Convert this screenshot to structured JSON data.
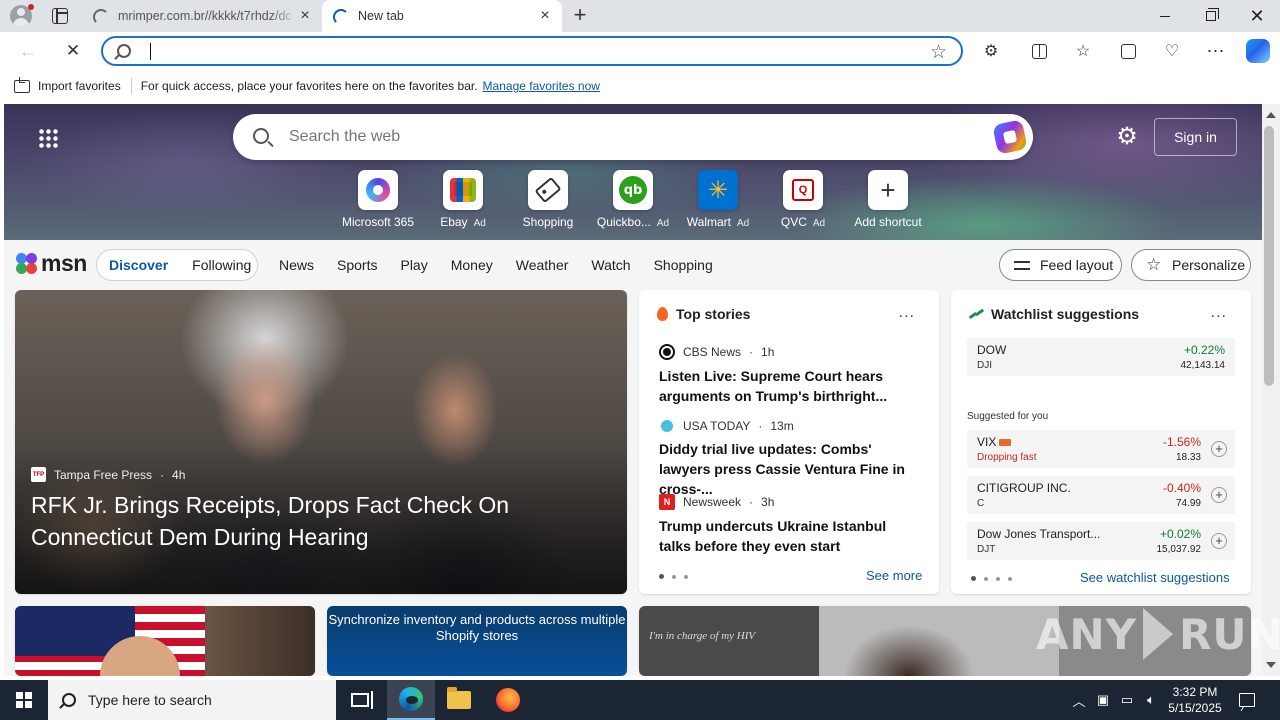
{
  "browser": {
    "tabs": [
      {
        "title": "mrimper.com.br//kkkk/t7rhdz/dc",
        "active": false
      },
      {
        "title": "New tab",
        "active": true
      }
    ],
    "address_value": "",
    "favorites_bar": {
      "import_label": "Import favorites",
      "message": "For quick access, place your favorites here on the favorites bar.",
      "manage_link": "Manage favorites now"
    }
  },
  "newtab": {
    "search_placeholder": "Search the web",
    "signin_label": "Sign in",
    "shortcuts": [
      {
        "label": "Microsoft 365",
        "ad": "",
        "icon": "microsoft-365-icon"
      },
      {
        "label": "Ebay",
        "ad": "Ad",
        "icon": "ebay-icon"
      },
      {
        "label": "Shopping",
        "ad": "",
        "icon": "tag-icon"
      },
      {
        "label": "Quickbo...",
        "ad": "Ad",
        "icon": "quickbooks-icon"
      },
      {
        "label": "Walmart",
        "ad": "Ad",
        "icon": "walmart-icon"
      },
      {
        "label": "QVC",
        "ad": "Ad",
        "icon": "qvc-icon"
      },
      {
        "label": "Add shortcut",
        "ad": "",
        "icon": "plus-icon"
      }
    ],
    "msn": {
      "logo": "msn",
      "pills": [
        "Discover",
        "Following"
      ],
      "links": [
        "News",
        "Sports",
        "Play",
        "Money",
        "Weather",
        "Watch",
        "Shopping"
      ],
      "feed_layout_label": "Feed layout",
      "personalize_label": "Personalize"
    },
    "hero": {
      "source": "Tampa Free Press",
      "time": "4h",
      "title": "RFK Jr. Brings Receipts, Drops Fact Check On Connecticut Dem During Hearing"
    },
    "top_stories": {
      "heading": "Top stories",
      "more": "...",
      "items": [
        {
          "source": "CBS News",
          "time": "1h",
          "title": "Listen Live: Supreme Court hears arguments on Trump's birthright..."
        },
        {
          "source": "USA TODAY",
          "time": "13m",
          "title": "Diddy trial live updates: Combs' lawyers press Cassie Ventura Fine in cross-..."
        },
        {
          "source": "Newsweek",
          "time": "3h",
          "title": "Trump undercuts Ukraine Istanbul talks before they even start"
        }
      ],
      "see_more": "See more"
    },
    "watchlist": {
      "heading": "Watchlist suggestions",
      "more": "...",
      "primary": {
        "name": "DOW",
        "symbol": "DJI",
        "change": "+0.22%",
        "value": "42,143.14"
      },
      "suggested_label": "Suggested for you",
      "suggested": [
        {
          "name": "VIX",
          "symbol": "Dropping fast",
          "change": "-1.56%",
          "value": "18.33",
          "trend": "down"
        },
        {
          "name": "CITIGROUP INC.",
          "symbol": "C",
          "change": "-0.40%",
          "value": "74.99",
          "trend": "down"
        },
        {
          "name": "Dow Jones Transport...",
          "symbol": "DJT",
          "change": "+0.02%",
          "value": "15,037.92",
          "trend": "up"
        }
      ],
      "see_all": "See watchlist suggestions"
    },
    "ad_card_text": "Synchronize inventory and products across multiple Shopify stores",
    "photo_caption": "I'm in charge of my HIV"
  },
  "watermark": {
    "left": "ANY",
    "right": "RUN"
  },
  "taskbar": {
    "search_placeholder": "Type here to search",
    "time": "3:32 PM",
    "date": "5/15/2025"
  },
  "colors": {
    "accent": "#0c59a4",
    "positive": "#0f7b3a",
    "negative": "#c42b1c"
  }
}
